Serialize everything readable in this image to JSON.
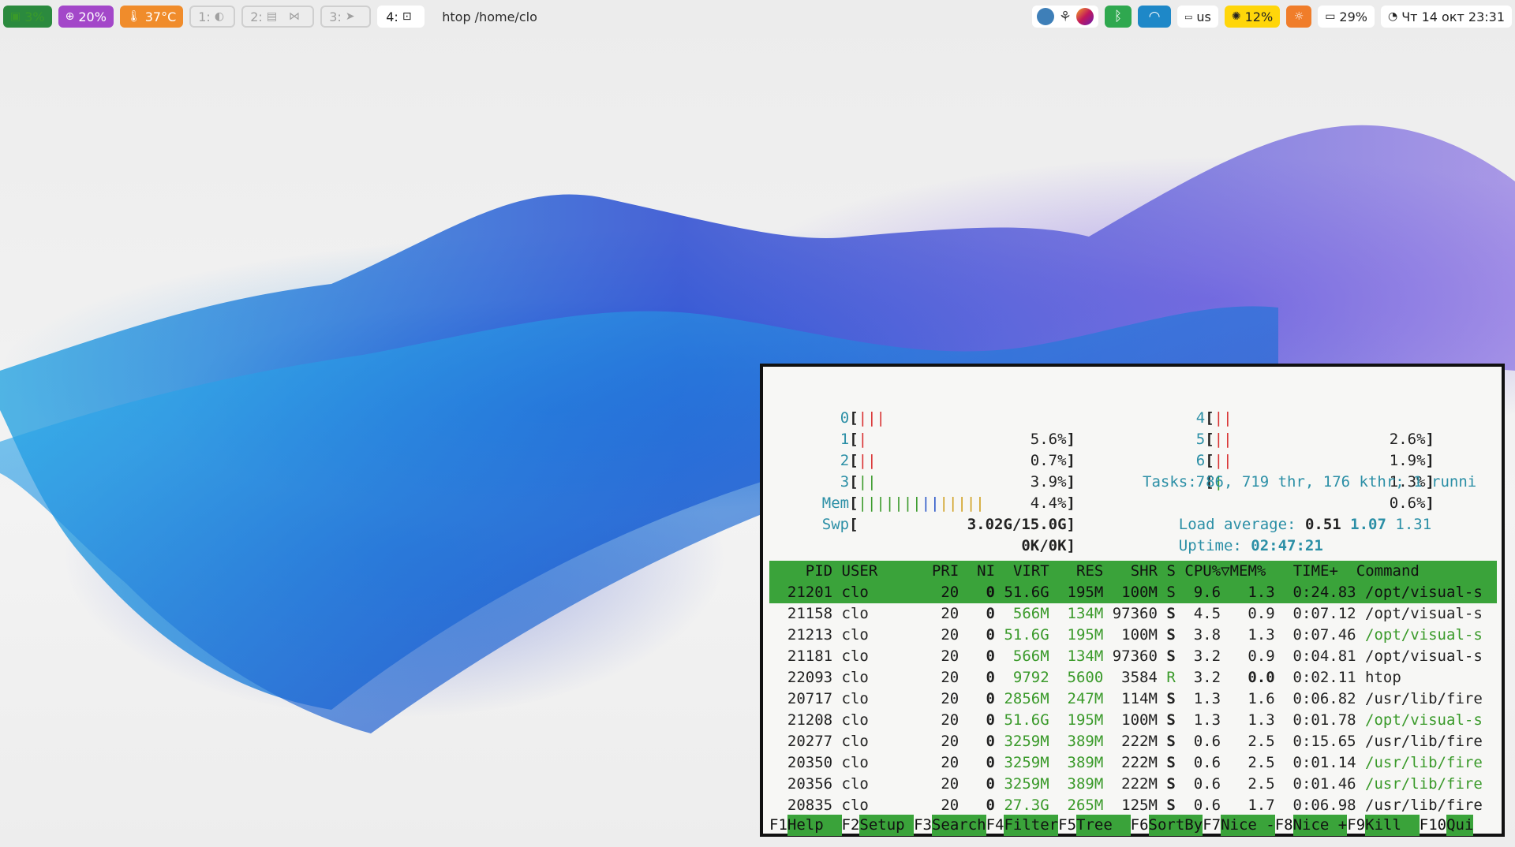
{
  "topbar": {
    "cpu": "3%",
    "mem": "20%",
    "temp": "37°C",
    "workspaces": [
      {
        "label": "1:",
        "icon": "firefox-icon"
      },
      {
        "label": "2:",
        "icon": "folder-icon"
      },
      {
        "label": "3:",
        "icon": "telegram-icon"
      },
      {
        "label": "4:",
        "icon": "terminal-icon"
      }
    ],
    "window_title": "htop /home/clo",
    "keyboard": "us",
    "brightness": "12%",
    "battery": "29%",
    "datetime": "Чт 14 окт 23:31"
  },
  "htop": {
    "cpus": [
      {
        "id": "0",
        "bars": "|||",
        "pct": "5.6%"
      },
      {
        "id": "1",
        "bars": "|",
        "pct": "0.7%"
      },
      {
        "id": "2",
        "bars": "||",
        "pct": "3.9%"
      },
      {
        "id": "3",
        "bars": "||",
        "pct": "4.4%"
      },
      {
        "id": "4",
        "bars": "||",
        "pct": "2.6%"
      },
      {
        "id": "5",
        "bars": "||",
        "pct": "1.9%"
      },
      {
        "id": "6",
        "bars": "||",
        "pct": "1.3%"
      },
      {
        "id": "7",
        "bars": "|",
        "pct": "0.6%"
      }
    ],
    "mem_label": "Mem",
    "mem_value": "3.02G/15.0G",
    "swp_label": "Swp",
    "swp_value": "0K/0K",
    "tasks": "Tasks: 86, 719 thr, 176 kthr; 1 runni",
    "load_label": "Load average:",
    "load": [
      "0.51",
      "1.07",
      "1.31"
    ],
    "uptime_label": "Uptime:",
    "uptime": "02:47:21",
    "columns": [
      "PID",
      "USER",
      "PRI",
      "NI",
      "VIRT",
      "RES",
      "SHR",
      "S",
      "CPU%",
      "MEM%",
      "TIME+",
      "Command"
    ],
    "processes": [
      {
        "pid": "21201",
        "user": "clo",
        "pri": "20",
        "ni": "0",
        "virt": "51.6G",
        "res": "195M",
        "shr": "100M",
        "s": "S",
        "cpu": "9.6",
        "mem": "1.3",
        "time": "0:24.83",
        "cmd": "/opt/visual-s"
      },
      {
        "pid": "21158",
        "user": "clo",
        "pri": "20",
        "ni": "0",
        "virt": "566M",
        "res": "134M",
        "shr": "97360",
        "s": "S",
        "cpu": "4.5",
        "mem": "0.9",
        "time": "0:07.12",
        "cmd": "/opt/visual-s"
      },
      {
        "pid": "21213",
        "user": "clo",
        "pri": "20",
        "ni": "0",
        "virt": "51.6G",
        "res": "195M",
        "shr": "100M",
        "s": "S",
        "cpu": "3.8",
        "mem": "1.3",
        "time": "0:07.46",
        "cmd": "/opt/visual-s"
      },
      {
        "pid": "21181",
        "user": "clo",
        "pri": "20",
        "ni": "0",
        "virt": "566M",
        "res": "134M",
        "shr": "97360",
        "s": "S",
        "cpu": "3.2",
        "mem": "0.9",
        "time": "0:04.81",
        "cmd": "/opt/visual-s"
      },
      {
        "pid": "22093",
        "user": "clo",
        "pri": "20",
        "ni": "0",
        "virt": "9792",
        "res": "5600",
        "shr": "3584",
        "s": "R",
        "cpu": "3.2",
        "mem": "0.0",
        "time": "0:02.11",
        "cmd": "htop"
      },
      {
        "pid": "20717",
        "user": "clo",
        "pri": "20",
        "ni": "0",
        "virt": "2856M",
        "res": "247M",
        "shr": "114M",
        "s": "S",
        "cpu": "1.3",
        "mem": "1.6",
        "time": "0:06.82",
        "cmd": "/usr/lib/fire"
      },
      {
        "pid": "21208",
        "user": "clo",
        "pri": "20",
        "ni": "0",
        "virt": "51.6G",
        "res": "195M",
        "shr": "100M",
        "s": "S",
        "cpu": "1.3",
        "mem": "1.3",
        "time": "0:01.78",
        "cmd": "/opt/visual-s"
      },
      {
        "pid": "20277",
        "user": "clo",
        "pri": "20",
        "ni": "0",
        "virt": "3259M",
        "res": "389M",
        "shr": "222M",
        "s": "S",
        "cpu": "0.6",
        "mem": "2.5",
        "time": "0:15.65",
        "cmd": "/usr/lib/fire"
      },
      {
        "pid": "20350",
        "user": "clo",
        "pri": "20",
        "ni": "0",
        "virt": "3259M",
        "res": "389M",
        "shr": "222M",
        "s": "S",
        "cpu": "0.6",
        "mem": "2.5",
        "time": "0:01.14",
        "cmd": "/usr/lib/fire"
      },
      {
        "pid": "20356",
        "user": "clo",
        "pri": "20",
        "ni": "0",
        "virt": "3259M",
        "res": "389M",
        "shr": "222M",
        "s": "S",
        "cpu": "0.6",
        "mem": "2.5",
        "time": "0:01.46",
        "cmd": "/usr/lib/fire"
      },
      {
        "pid": "20835",
        "user": "clo",
        "pri": "20",
        "ni": "0",
        "virt": "27.3G",
        "res": "265M",
        "shr": "125M",
        "s": "S",
        "cpu": "0.6",
        "mem": "1.7",
        "time": "0:06.98",
        "cmd": "/usr/lib/fire"
      }
    ],
    "fkeys": [
      {
        "key": "F1",
        "label": "Help  "
      },
      {
        "key": "F2",
        "label": "Setup "
      },
      {
        "key": "F3",
        "label": "Search"
      },
      {
        "key": "F4",
        "label": "Filter"
      },
      {
        "key": "F5",
        "label": "Tree  "
      },
      {
        "key": "F6",
        "label": "SortBy"
      },
      {
        "key": "F7",
        "label": "Nice -"
      },
      {
        "key": "F8",
        "label": "Nice +"
      },
      {
        "key": "F9",
        "label": "Kill  "
      },
      {
        "key": "F10",
        "label": "Qui"
      }
    ]
  }
}
